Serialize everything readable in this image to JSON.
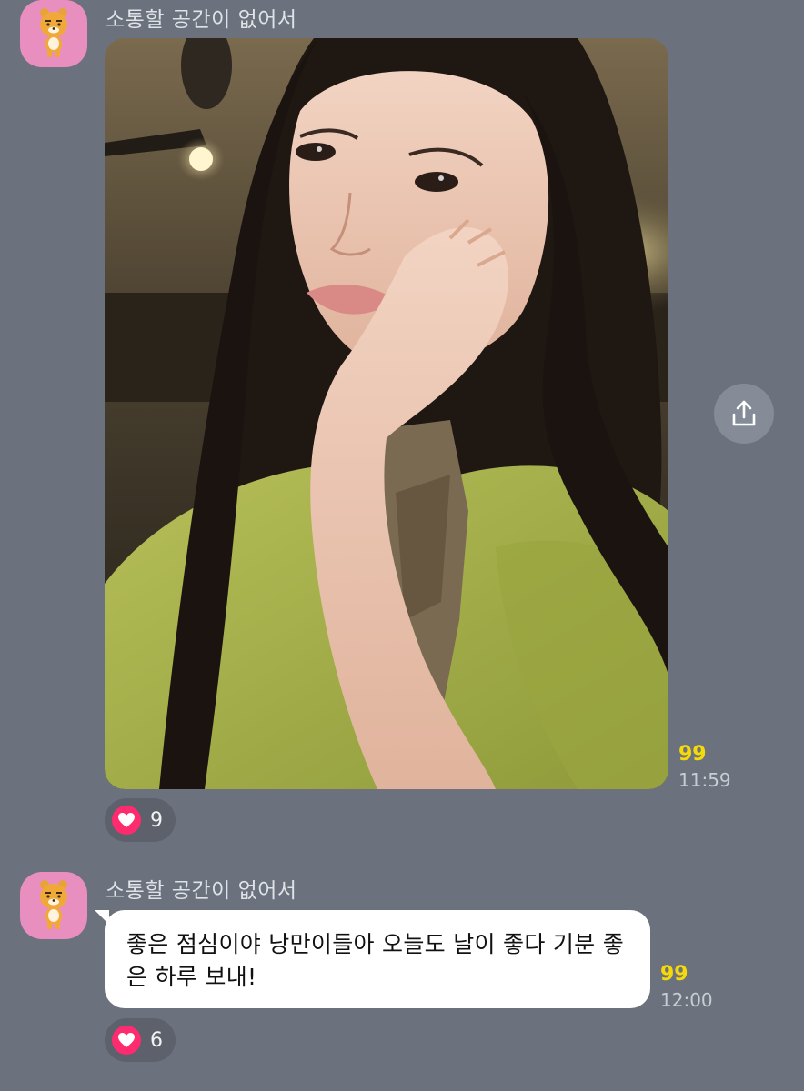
{
  "messages": [
    {
      "sender": "소통할 공간이 없어서",
      "avatar_icon": "ryan-character-icon",
      "type": "photo",
      "unread": "99",
      "time": "11:59",
      "reaction": {
        "icon": "heart-icon",
        "count": "9"
      },
      "share_icon": "share-upload-icon"
    },
    {
      "sender": "소통할 공간이 없어서",
      "avatar_icon": "ryan-character-icon",
      "type": "text",
      "text": "좋은 점심이야 낭만이들아 오늘도 날이 좋다 기분 좋은 하루 보내!",
      "unread": "99",
      "time": "12:00",
      "reaction": {
        "icon": "heart-icon",
        "count": "6"
      }
    }
  ],
  "colors": {
    "background": "#6b717d",
    "avatar_bg": "#e88fc0",
    "unread": "#f5d90a",
    "heart": "#ff2b6f",
    "bubble": "#ffffff"
  }
}
